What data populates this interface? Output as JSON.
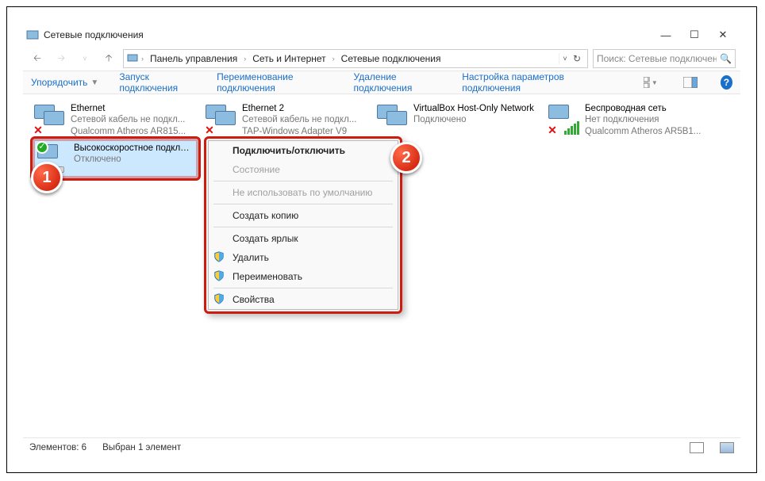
{
  "window": {
    "title": "Сетевые подключения"
  },
  "breadcrumb": {
    "items": [
      "Панель управления",
      "Сеть и Интернет",
      "Сетевые подключения"
    ]
  },
  "search": {
    "placeholder": "Поиск: Сетевые подключения"
  },
  "toolbar": {
    "organize": "Упорядочить",
    "start": "Запуск подключения",
    "rename": "Переименование подключения",
    "delete": "Удаление подключения",
    "settings": "Настройка параметров подключения"
  },
  "connections": [
    {
      "name": "Ethernet",
      "line2": "Сетевой кабель не подкл...",
      "line3": "Qualcomm Atheros AR815...",
      "icon": "lan-x"
    },
    {
      "name": "Ethernet 2",
      "line2": "Сетевой кабель не подкл...",
      "line3": "TAP-Windows Adapter V9",
      "icon": "lan-x"
    },
    {
      "name": "VirtualBox Host-Only Network",
      "line2": "Подключено",
      "line3": "",
      "icon": "lan"
    },
    {
      "name": "Беспроводная сеть",
      "line2": "Нет подключения",
      "line3": "Qualcomm Atheros AR5B1...",
      "icon": "wifi-x"
    }
  ],
  "selected": {
    "name": "Высокоскоростное подключение",
    "line2": "Отключено",
    "line3": ""
  },
  "context_menu": {
    "connect": "Подключить/отключить",
    "status": "Состояние",
    "nodefault": "Не использовать по умолчанию",
    "copy": "Создать копию",
    "shortcut": "Создать ярлык",
    "delete": "Удалить",
    "rename": "Переименовать",
    "props": "Свойства"
  },
  "markers": {
    "one": "1",
    "two": "2"
  },
  "statusbar": {
    "count_label": "Элементов: 6",
    "sel_label": "Выбран 1 элемент"
  }
}
